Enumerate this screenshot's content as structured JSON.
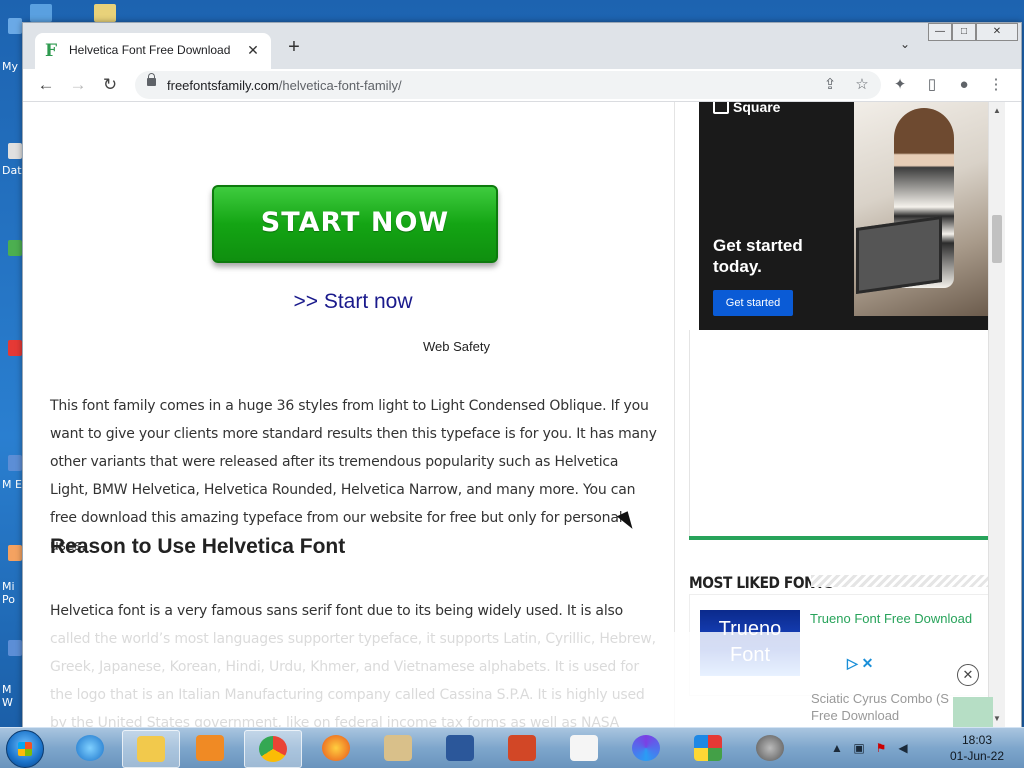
{
  "desktop": {
    "labels": [
      {
        "text": "My"
      },
      {
        "text": "Dat"
      },
      {
        "text": "M E"
      },
      {
        "text": "Mi Po"
      },
      {
        "text": "M W"
      }
    ]
  },
  "browser": {
    "tab": {
      "title": "Helvetica Font Free Download",
      "favicon": "F"
    },
    "new_tab": "+",
    "tab_menu": "⌄",
    "window_controls": {
      "minimize": "—",
      "maximize": "□",
      "close": "✕"
    },
    "nav": {
      "back": "←",
      "forward": "→",
      "reload": "↻"
    },
    "url": {
      "domain": "freefontsfamily.com",
      "path": "/helvetica-font-family/"
    }
  },
  "page": {
    "start_button": "START NOW",
    "start_link": ">> Start now",
    "web_safety": "Web Safety",
    "paragraph1": "This font family comes in a huge 36 styles from light to Light Condensed Oblique. If you want to give your clients more standard results then this typeface is for you. It has many other variants that were released after its tremendous popularity such as Helvetica Light, BMW Helvetica, Helvetica Rounded, Helvetica Narrow, and many more. You can free download this amazing typeface from our website for free but only for personal uses.",
    "heading": "Reason to Use Helvetica Font",
    "paragraph2": "Helvetica font is a very famous sans serif font due to its being widely used. It is also called the world’s most languages supporter typeface, it supports Latin, Cyrillic, Hebrew, Greek, Japanese, Korean, Hindi, Urdu, Khmer, and Vietnamese alphabets. It is used for the logo that is an Italian Manufacturing company called Cassina S.P.A. It is highly used by the United States government, like on federal income tax forms as well as NASA utilized on the Space Shuttle Orbiter."
  },
  "sidebar": {
    "ad": {
      "brand": "Square",
      "headline": "Get started today.",
      "cta": "Get started"
    },
    "most_liked_title": "MOST LIKED FONTS",
    "font_card": {
      "thumb_text": "Trueno Font",
      "title": "Trueno Font Free Download"
    },
    "faded_text_1": "Sciatic Cyrus Combo (S",
    "faded_text_2": "Free Download",
    "adchoices": "▷ ✕",
    "ad_close": "✕"
  },
  "taskbar": {
    "clock_time": "18:03",
    "clock_date": "01-Jun-22"
  },
  "colors": {
    "accent_green": "#27a35a",
    "start_button_green": "#14a514",
    "link_blue": "#1a1a8c",
    "ad_cta_blue": "#0a5bd6"
  }
}
